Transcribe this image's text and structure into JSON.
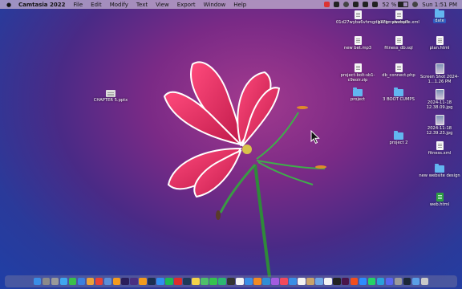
{
  "menubar": {
    "apple": "",
    "app_name": "Camtasia 2022",
    "menus": [
      "File",
      "Edit",
      "Modify",
      "Text",
      "View",
      "Export",
      "Window",
      "Help"
    ],
    "battery_percent": "52 %",
    "battery_level": 0.52,
    "clock": "Sun 1:51 PM"
  },
  "desktop": {
    "items": [
      {
        "label": "01d27wyba6vhmgdg77g...als.mp3",
        "icon": "audio-file-icon"
      },
      {
        "label": "backmywebsite.xml",
        "icon": "xml-file-icon"
      },
      {
        "label": "date",
        "icon": "folder-icon"
      },
      {
        "label": "new bet.mp3",
        "icon": "audio-file-icon"
      },
      {
        "label": "fitness_db.sql",
        "icon": "sql-file-icon"
      },
      {
        "label": "plan.html",
        "icon": "html-file-icon"
      },
      {
        "label": "project-bolt-sb1-c9eoir.zip",
        "icon": "zip-file-icon"
      },
      {
        "label": "db_connect.php",
        "icon": "php-file-icon"
      },
      {
        "label": "Screen Shot 2024-1...1.26 PM",
        "icon": "screenshot-icon"
      },
      {
        "label": "CHAPTER 5.pptx",
        "icon": "pptx-file-icon"
      },
      {
        "label": "project",
        "icon": "folder-icon"
      },
      {
        "label": "3 BOOT CUMPS",
        "icon": "folder-icon"
      },
      {
        "label": "2024-11-18 12.38.09.jpg",
        "icon": "image-file-icon"
      },
      {
        "label": "2024-11-18 12.39.23.jpg",
        "icon": "image-file-icon"
      },
      {
        "label": "project 2",
        "icon": "folder-icon"
      },
      {
        "label": "fitness.xml",
        "icon": "xml-file-icon"
      },
      {
        "label": "new website design",
        "icon": "folder-icon"
      },
      {
        "label": "web.html",
        "icon": "html-file-icon"
      }
    ]
  },
  "dock": {
    "apps": [
      {
        "name": "finder-icon",
        "color": "#3a8ee6"
      },
      {
        "name": "launchpad-icon",
        "color": "#8a8a8a"
      },
      {
        "name": "settings-icon",
        "color": "#9a9a9a"
      },
      {
        "name": "safari-icon",
        "color": "#3fa6ef"
      },
      {
        "name": "messages-icon",
        "color": "#39c04a"
      },
      {
        "name": "mail-icon",
        "color": "#3b7fe0"
      },
      {
        "name": "photos-icon",
        "color": "#e9a23b"
      },
      {
        "name": "chrome-icon",
        "color": "#e94235"
      },
      {
        "name": "finder-alt-icon",
        "color": "#5a8fd8"
      },
      {
        "name": "illustrator-icon",
        "color": "#f29a1e"
      },
      {
        "name": "premiere-icon",
        "color": "#2a1e5c"
      },
      {
        "name": "after-effects-icon",
        "color": "#4a2f82"
      },
      {
        "name": "ai-icon",
        "color": "#f29a1e"
      },
      {
        "name": "photoshop-icon",
        "color": "#1b2f52"
      },
      {
        "name": "photoshop-alt-icon",
        "color": "#2f8ef0"
      },
      {
        "name": "spotify-icon",
        "color": "#1db954"
      },
      {
        "name": "acrobat-icon",
        "color": "#dd2c2c"
      },
      {
        "name": "audition-icon",
        "color": "#1e3a5a"
      },
      {
        "name": "notes-icon",
        "color": "#f3d34a"
      },
      {
        "name": "maps-icon",
        "color": "#4fbf6a"
      },
      {
        "name": "facetime-icon",
        "color": "#35c24f"
      },
      {
        "name": "camtasia-icon",
        "color": "#2bb673"
      },
      {
        "name": "terminal-icon",
        "color": "#333333"
      },
      {
        "name": "calendar-icon",
        "color": "#f2f2f2"
      },
      {
        "name": "xcode-icon",
        "color": "#3a8ee6"
      },
      {
        "name": "books-icon",
        "color": "#f08a24"
      },
      {
        "name": "vscode-icon",
        "color": "#2f8ed6"
      },
      {
        "name": "podcasts-icon",
        "color": "#a35ce0"
      },
      {
        "name": "music-icon",
        "color": "#f24a5c"
      },
      {
        "name": "app-store-icon",
        "color": "#3a8ee6"
      },
      {
        "name": "reminders-icon",
        "color": "#f2f2f2"
      },
      {
        "name": "contacts-icon",
        "color": "#c9a36b"
      },
      {
        "name": "preview-icon",
        "color": "#6fa7e6"
      },
      {
        "name": "notion-icon",
        "color": "#f2f2f2"
      },
      {
        "name": "github-icon",
        "color": "#222222"
      },
      {
        "name": "slack-icon",
        "color": "#4a154b"
      },
      {
        "name": "figma-icon",
        "color": "#f24e1e"
      },
      {
        "name": "zoom-icon",
        "color": "#2d8cff"
      },
      {
        "name": "whatsapp-icon",
        "color": "#25d366"
      },
      {
        "name": "telegram-icon",
        "color": "#2aa1da"
      },
      {
        "name": "discord-icon",
        "color": "#5865f2"
      },
      {
        "name": "utility-icon",
        "color": "#9a9a9a"
      },
      {
        "name": "steam-icon",
        "color": "#1b2838"
      },
      {
        "name": "downloads-icon",
        "color": "#5a9fe6"
      },
      {
        "name": "trash-icon",
        "color": "#c9c9c9"
      }
    ]
  }
}
